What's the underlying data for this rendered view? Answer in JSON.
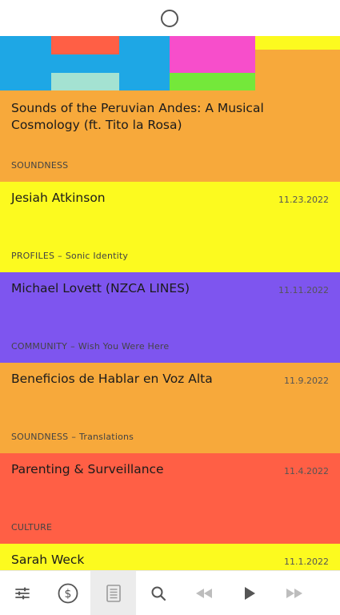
{
  "colors": {
    "orange": "#f7a93b",
    "yellow": "#fcfa1f",
    "purple": "#7e55ef",
    "red": "#ff5f45",
    "blue": "#1ea7e5",
    "pink": "#f74ecb",
    "green": "#74e83a",
    "mint": "#a4e2d2"
  },
  "feed": {
    "items": [
      {
        "title": "Sounds of the Peruvian Andes: A Musical Cosmology (ft. Tito la Rosa)",
        "date": "",
        "category": "SOUNDNESS",
        "series": "",
        "color": "#f7a93b"
      },
      {
        "title": "Jesiah Atkinson",
        "date": "11.23.2022",
        "category": "PROFILES",
        "series": "Sonic Identity",
        "color": "#fcfa1f"
      },
      {
        "title": "Michael Lovett (NZCA LINES)",
        "date": "11.11.2022",
        "category": "COMMUNITY",
        "series": "Wish You Were Here",
        "color": "#7e55ef"
      },
      {
        "title": "Beneficios de Hablar en Voz Alta",
        "date": "11.9.2022",
        "category": "SOUNDNESS",
        "series": "Translations",
        "color": "#f7a93b"
      },
      {
        "title": "Parenting & Surveillance",
        "date": "11.4.2022",
        "category": "CULTURE",
        "series": "",
        "color": "#ff5f45"
      },
      {
        "title": "Sarah Weck",
        "date": "11.1.2022",
        "category": "",
        "series": "",
        "color": "#fcfa1f"
      }
    ],
    "separator": "–"
  },
  "bottom_nav": [
    {
      "icon": "sliders-icon",
      "active": false
    },
    {
      "icon": "dollar-circle-icon",
      "active": false
    },
    {
      "icon": "document-icon",
      "active": true
    },
    {
      "icon": "search-icon",
      "active": false
    },
    {
      "icon": "rewind-icon",
      "active": false
    },
    {
      "icon": "play-icon",
      "active": false
    },
    {
      "icon": "fast-forward-icon",
      "active": false
    }
  ]
}
